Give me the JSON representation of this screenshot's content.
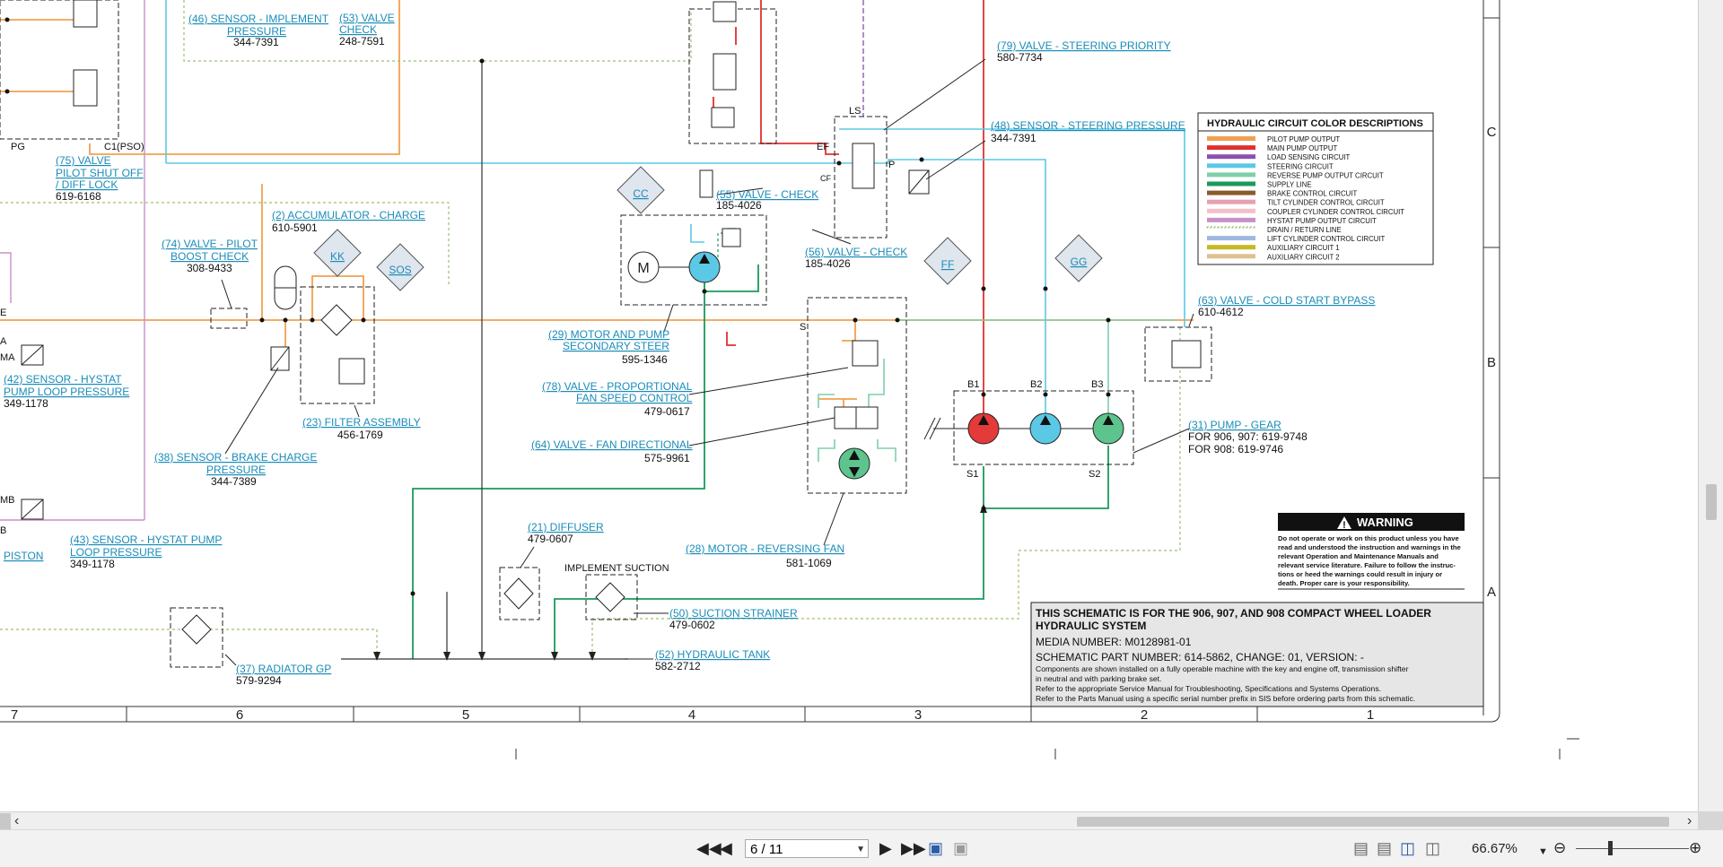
{
  "components": [
    {
      "label": "(46) SENSOR - IMPLEMENT",
      "label2": "PRESSURE",
      "part": "344-7391"
    },
    {
      "label": "(53) VALVE",
      "label2": "CHECK",
      "part": "248-7591"
    },
    {
      "label": "(75) VALVE",
      "label2": "PILOT SHUT OFF",
      "label3": "/ DIFF LOCK",
      "part": "619-6168"
    },
    {
      "label": "(79) VALVE - STEERING PRIORITY",
      "part": "580-7734"
    },
    {
      "label": "(48) SENSOR - STEERING PRESSURE",
      "part": "344-7391"
    },
    {
      "label": "(55) VALVE - CHECK",
      "part": "185-4026"
    },
    {
      "label": "(56) VALVE - CHECK",
      "part": "185-4026"
    },
    {
      "label": "(2) ACCUMULATOR - CHARGE",
      "part": "610-5901"
    },
    {
      "label": "(74) VALVE - PILOT",
      "label2": "BOOST CHECK",
      "part": "308-9433"
    },
    {
      "label": "(29) MOTOR AND PUMP",
      "label2": "SECONDARY STEER",
      "part": "595-1346"
    },
    {
      "label": "(63) VALVE - COLD START BYPASS",
      "part": "610-4612"
    },
    {
      "label": "(42) SENSOR - HYSTAT",
      "label2": "PUMP LOOP PRESSURE",
      "part": "349-1178"
    },
    {
      "label": "(78) VALVE - PROPORTIONAL",
      "label2": "FAN SPEED CONTROL",
      "part": "479-0617"
    },
    {
      "label": "(23) FILTER ASSEMBLY",
      "part": "456-1769"
    },
    {
      "label": "(31) PUMP - GEAR",
      "line2": "FOR 906, 907: 619-9748",
      "line3": "FOR 908: 619-9746"
    },
    {
      "label": "(38) SENSOR - BRAKE CHARGE",
      "label2": "PRESSURE",
      "part": "344-7389"
    },
    {
      "label": "(64) VALVE - FAN DIRECTIONAL",
      "part": "575-9961"
    },
    {
      "label": "(43) SENSOR - HYSTAT PUMP",
      "label2": "LOOP PRESSURE",
      "part": "349-1178"
    },
    {
      "label": "(21) DIFFUSER",
      "part": "479-0607"
    },
    {
      "label": "(28) MOTOR - REVERSING FAN",
      "part": "581-1069"
    },
    {
      "label": "(50) SUCTION STRAINER",
      "part": "479-0602"
    },
    {
      "label": "(37) RADIATOR GP",
      "part": "579-9294"
    },
    {
      "label": "(52) HYDRAULIC TANK",
      "part": "582-2712"
    }
  ],
  "misc_labels": {
    "implement_suction": "IMPLEMENT SUCTION",
    "piston": "PISTON",
    "pg": "PG",
    "c1pso": "C1(PSO)",
    "ls": "LS",
    "ef": "EF",
    "cf": "CF",
    "p": "P",
    "s": "S",
    "b1": "B1",
    "b2": "B2",
    "b3": "B3",
    "s1": "S1",
    "s2": "S2",
    "ma": "MA",
    "mb": "MB",
    "a": "A",
    "b": "B",
    "e": "E"
  },
  "diamonds": [
    "CC",
    "KK",
    "SOS",
    "FF",
    "GG"
  ],
  "legend": {
    "title": "HYDRAULIC CIRCUIT COLOR DESCRIPTIONS",
    "items": [
      {
        "name": "PILOT PUMP OUTPUT",
        "color": "#f0a050"
      },
      {
        "name": "MAIN PUMP OUTPUT",
        "color": "#e03030"
      },
      {
        "name": "LOAD SENSING CIRCUIT",
        "color": "#8a4fb0"
      },
      {
        "name": "STEERING CIRCUIT",
        "color": "#5bc8e6"
      },
      {
        "name": "REVERSE PUMP OUTPUT CIRCUIT",
        "color": "#7fcfa8"
      },
      {
        "name": "SUPPLY LINE",
        "color": "#1a9a5a"
      },
      {
        "name": "BRAKE CONTROL CIRCUIT",
        "color": "#8b5a2b"
      },
      {
        "name": "TILT CYLINDER CONTROL CIRCUIT",
        "color": "#e8a0b0"
      },
      {
        "name": "COUPLER CYLINDER CONTROL CIRCUIT",
        "color": "#f4c0c8"
      },
      {
        "name": "HYSTAT PUMP OUTPUT CIRCUIT",
        "color": "#c890c8"
      },
      {
        "name": "DRAIN / RETURN LINE",
        "color": "#9ac070"
      },
      {
        "name": "LIFT CYLINDER CONTROL CIRCUIT",
        "color": "#a0b8e0"
      },
      {
        "name": "AUXILIARY CIRCUIT 1",
        "color": "#c8b820"
      },
      {
        "name": "AUXILIARY CIRCUIT 2",
        "color": "#e0c090"
      }
    ]
  },
  "warning": {
    "title": "WARNING",
    "lines": [
      "Do not operate or work on this product unless you have",
      "read and understood the instruction and warnings in the",
      "relevant Operation and Maintenance Manuals and",
      "relevant service literature. Failure to follow the instruc-",
      "tions or heed the warnings could result in injury or",
      "death. Proper care is your responsibility."
    ]
  },
  "titleblock": {
    "line1": "THIS SCHEMATIC IS FOR THE 906, 907, AND 908 COMPACT WHEEL LOADER",
    "line2": "HYDRAULIC SYSTEM",
    "media": "MEDIA NUMBER: M0128981-01",
    "part": "SCHEMATIC PART NUMBER: 614-5862, CHANGE: 01, VERSION: -",
    "notes": [
      "Components are shown installed on a fully operable machine with the key and engine off, transmission shifter",
      "in neutral and with parking brake set.",
      "Refer to the appropriate Service Manual for Troubleshooting, Specifications and Systems Operations.",
      "Refer to the Parts Manual using a specific serial number prefix in SIS before ordering parts from this schematic."
    ]
  },
  "grid_columns": [
    "7",
    "6",
    "5",
    "4",
    "3",
    "2",
    "1"
  ],
  "grid_rows": [
    "C",
    "B",
    "A"
  ],
  "viewer": {
    "page_indicator": "6 / 11",
    "zoom": "66.67%"
  }
}
